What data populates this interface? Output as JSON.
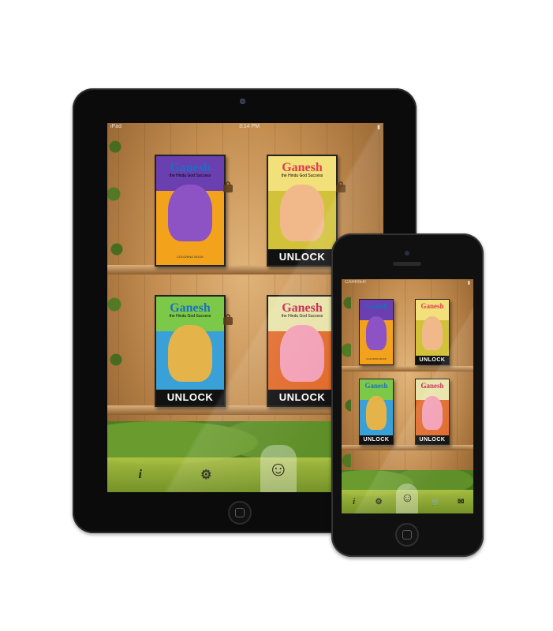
{
  "status": {
    "carrier_ipad": "iPad",
    "time_ipad": "3:14 PM",
    "carrier_iphone": "CARRIER"
  },
  "books": [
    {
      "title": "Ganesh",
      "subtitle": "the Hindu God Success",
      "footer": "COLORING BOOK",
      "locked": false,
      "cover": "#6a3fb0",
      "bg": "#f3a21c",
      "figure": "#8d52c4",
      "title_color": "#1b6fc0"
    },
    {
      "title": "Ganesh",
      "subtitle": "the Hindu God Success",
      "footer": "",
      "locked": true,
      "cover": "#f2e07a",
      "bg": "#d2c23a",
      "figure": "#f1b98a",
      "title_color": "#e33a53"
    },
    {
      "title": "Ganesh",
      "subtitle": "the Hindu God Success",
      "footer": "",
      "locked": true,
      "cover": "#7cc94a",
      "bg": "#3aa0d8",
      "figure": "#e4b44a",
      "title_color": "#1b6fc0"
    },
    {
      "title": "Ganesh",
      "subtitle": "the Hindu God Success",
      "footer": "",
      "locked": true,
      "cover": "#e8e3a8",
      "bg": "#e06a2a",
      "figure": "#f29fb4",
      "title_color": "#c4224a"
    }
  ],
  "unlock_label": "UNLOCK",
  "toolbar": {
    "info": "i",
    "settings": "⚙",
    "cart": "🛒",
    "mail": "✉"
  }
}
